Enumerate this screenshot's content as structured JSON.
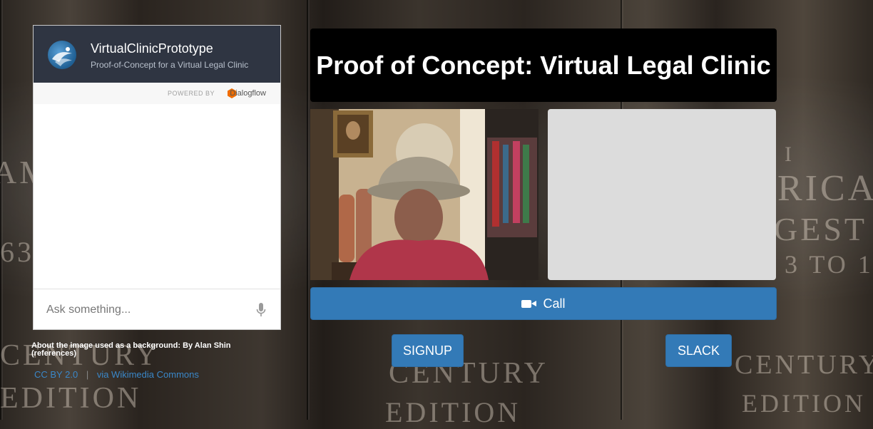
{
  "chat": {
    "title": "VirtualClinicPrototype",
    "subtitle": "Proof-of-Concept for a Virtual Legal Clinic",
    "powered_by": "POWERED BY",
    "powered_brand": "Dialogflow",
    "input_placeholder": "Ask something..."
  },
  "attribution": {
    "about_text": "About the image used as a background: By Alan Shin (references)",
    "license_link": "CC BY 2.0",
    "source_link": "via Wikimedia Commons"
  },
  "hero": {
    "title": "Proof of Concept: Virtual Legal Clinic"
  },
  "buttons": {
    "call": "Call",
    "signup": "SIGNUP",
    "slack": "SLACK"
  },
  "colors": {
    "primary_button": "#337ab7",
    "chat_header": "#2f3542",
    "hero_bg": "#000000",
    "remote_video_bg": "#dcdcdc"
  },
  "icons": [
    "video-camera-icon",
    "microphone-icon",
    "dialogflow-logo-icon"
  ]
}
